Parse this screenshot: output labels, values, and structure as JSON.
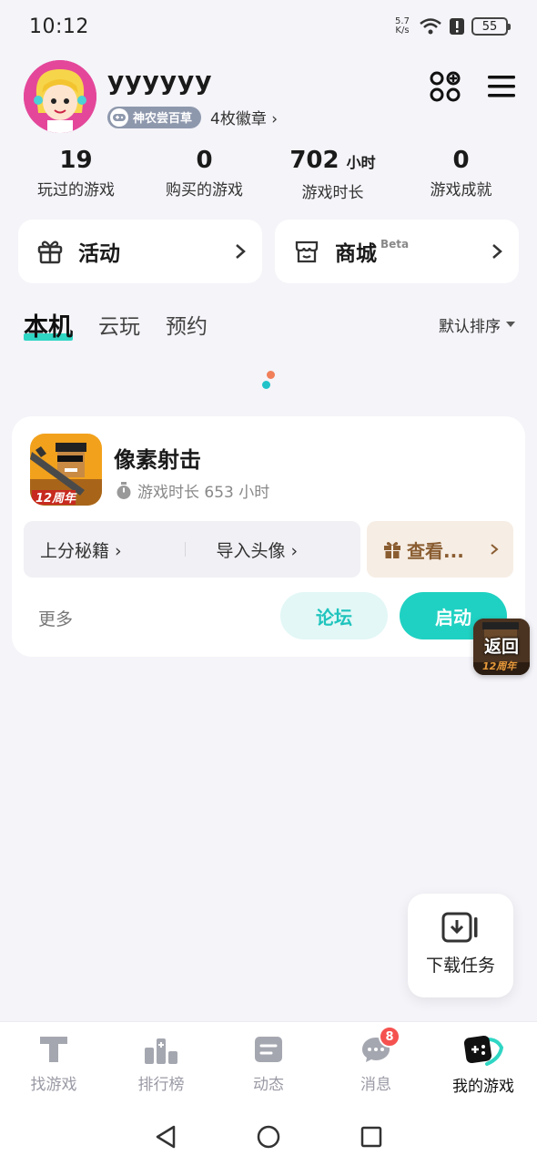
{
  "status_bar": {
    "time": "10:12",
    "net_speed_value": "5.7",
    "net_speed_unit": "K/s",
    "battery": "55"
  },
  "profile": {
    "username": "yyyyyy",
    "tag_label": "神农尝百草",
    "badge_count": "4枚徽章 ›"
  },
  "stats": [
    {
      "value": "19",
      "unit": "",
      "label": "玩过的游戏"
    },
    {
      "value": "0",
      "unit": "",
      "label": "购买的游戏"
    },
    {
      "value": "702",
      "unit": "小时",
      "label": "游戏时长"
    },
    {
      "value": "0",
      "unit": "",
      "label": "游戏成就"
    }
  ],
  "actions": {
    "activity_label": "活动",
    "store_label": "商城",
    "store_beta": "Beta"
  },
  "tabs": [
    {
      "label": "本机"
    },
    {
      "label": "云玩"
    },
    {
      "label": "预约"
    }
  ],
  "sort_label": "默认排序",
  "game": {
    "title": "像素射击",
    "playtime": "游戏时长 653 小时",
    "icon_badge": "12周年",
    "link_tips": "上分秘籍 ›",
    "link_avatar": "导入头像 ›",
    "gift_label": "查看...",
    "more_label": "更多",
    "forum_label": "论坛",
    "launch_label": "启动"
  },
  "float_return": {
    "label": "返回",
    "sub": "12周年"
  },
  "download_task": {
    "label": "下载任务"
  },
  "bottom_nav": [
    {
      "label": "找游戏"
    },
    {
      "label": "排行榜"
    },
    {
      "label": "动态"
    },
    {
      "label": "消息",
      "badge": "8"
    },
    {
      "label": "我的游戏"
    }
  ],
  "colors": {
    "accent": "#1fd1c2",
    "badge": "#f5524f",
    "gift_text": "#8a5d31"
  }
}
